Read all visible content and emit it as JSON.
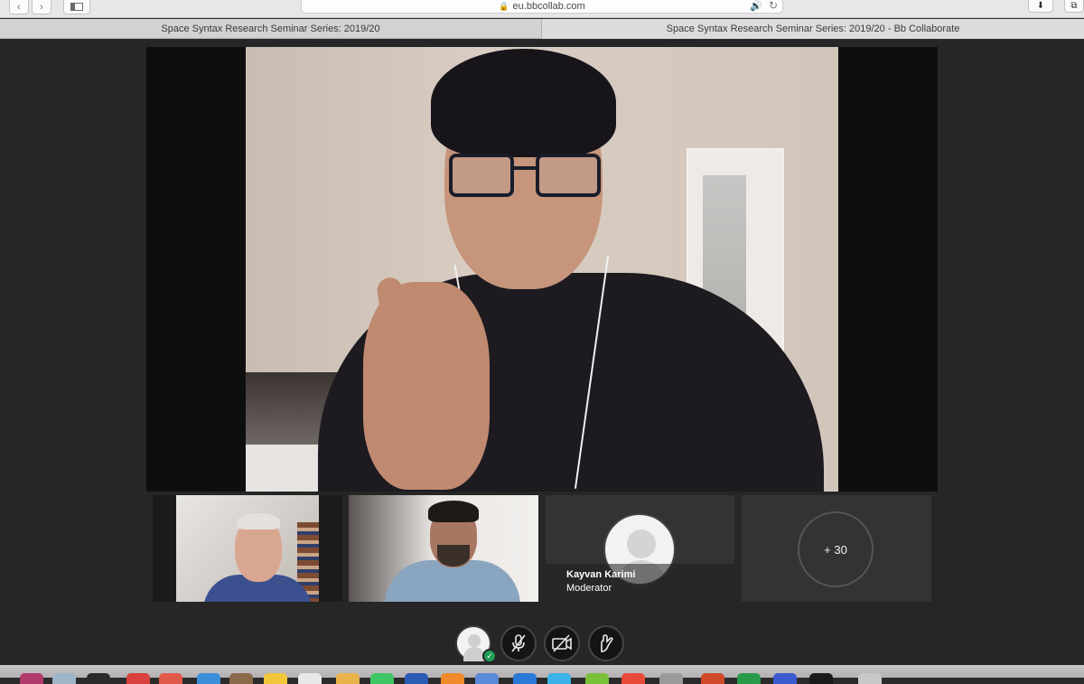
{
  "browser": {
    "url": "eu.bbcollab.com",
    "tabs": [
      {
        "title": "Space Syntax Research Seminar Series: 2019/20"
      },
      {
        "title": "Space Syntax Research Seminar Series: 2019/20 - Bb Collaborate"
      }
    ],
    "icons": [
      "back-icon",
      "forward-icon",
      "sidebar-icon",
      "lock-icon",
      "speaker-icon",
      "reload-icon",
      "download-icon",
      "tabs-overview-icon"
    ]
  },
  "session": {
    "participants": [
      {
        "role_label": "",
        "name": ""
      },
      {
        "role_label": "",
        "name": ""
      },
      {
        "name": "Kayvan Karimi",
        "role": "Moderator"
      }
    ],
    "more_count": "+ 30"
  },
  "controls": {
    "items": [
      "my-status-avatar",
      "microphone-muted-icon",
      "camera-off-icon",
      "raise-hand-icon"
    ]
  },
  "colors": {
    "background": "#262626",
    "status_ok": "#1f9e57",
    "tile": "#333333"
  }
}
